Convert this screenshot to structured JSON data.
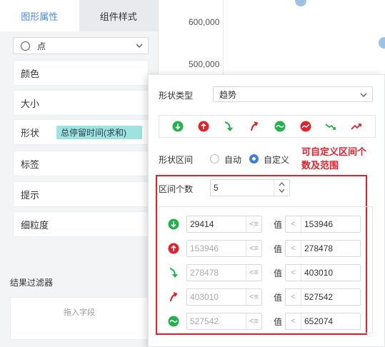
{
  "left_panel": {
    "tabs": [
      {
        "label": "图形属性",
        "active": true
      },
      {
        "label": "组件样式",
        "active": false
      }
    ],
    "mark_type": {
      "label": "点",
      "icon": "circle-icon"
    },
    "fields": [
      {
        "label": "颜色"
      },
      {
        "label": "大小"
      },
      {
        "label": "形状",
        "tag": "总停留时间(求和)"
      },
      {
        "label": "标签"
      },
      {
        "label": "提示"
      },
      {
        "label": "细粒度"
      }
    ],
    "filter": {
      "title": "结果过滤器",
      "placeholder": "拖入字段"
    }
  },
  "chart": {
    "y_ticks": [
      "600,000",
      "500,000"
    ],
    "point_color": "#9ec2e6"
  },
  "popup": {
    "shape_type_label": "形状类型",
    "shape_type_value": "趋势",
    "shape_range_label": "形状区间",
    "radio_auto": "自动",
    "radio_custom": "自定义",
    "selected_mode": "自定义",
    "note": "可自定义区间个数及范围",
    "interval_count_label": "区间个数",
    "interval_count_value": "5",
    "value_label": "值",
    "icons": [
      "arrow-down-green-icon",
      "arrow-up-red-icon",
      "arrow-down-right-green-icon",
      "arrow-up-right-red-icon",
      "wave-green-icon",
      "wave-red-icon",
      "trend-down-green-icon",
      "trend-up-red-icon"
    ],
    "ranges": [
      {
        "icon": "arrow-down-green-icon",
        "min": "29414",
        "max": "153946",
        "min_editable": true
      },
      {
        "icon": "arrow-up-red-icon",
        "min": "153946",
        "max": "278478",
        "min_editable": false
      },
      {
        "icon": "arrow-down-right-green-icon",
        "min": "278478",
        "max": "403010",
        "min_editable": false
      },
      {
        "icon": "arrow-up-right-red-icon",
        "min": "403010",
        "max": "527542",
        "min_editable": false
      },
      {
        "icon": "wave-green-icon",
        "min": "527542",
        "max": "652074",
        "min_editable": false
      }
    ],
    "colors": {
      "green": "#21b24a",
      "red": "#e6202a",
      "accent": "#3b7fe0",
      "highlight": "#e6202a"
    }
  }
}
